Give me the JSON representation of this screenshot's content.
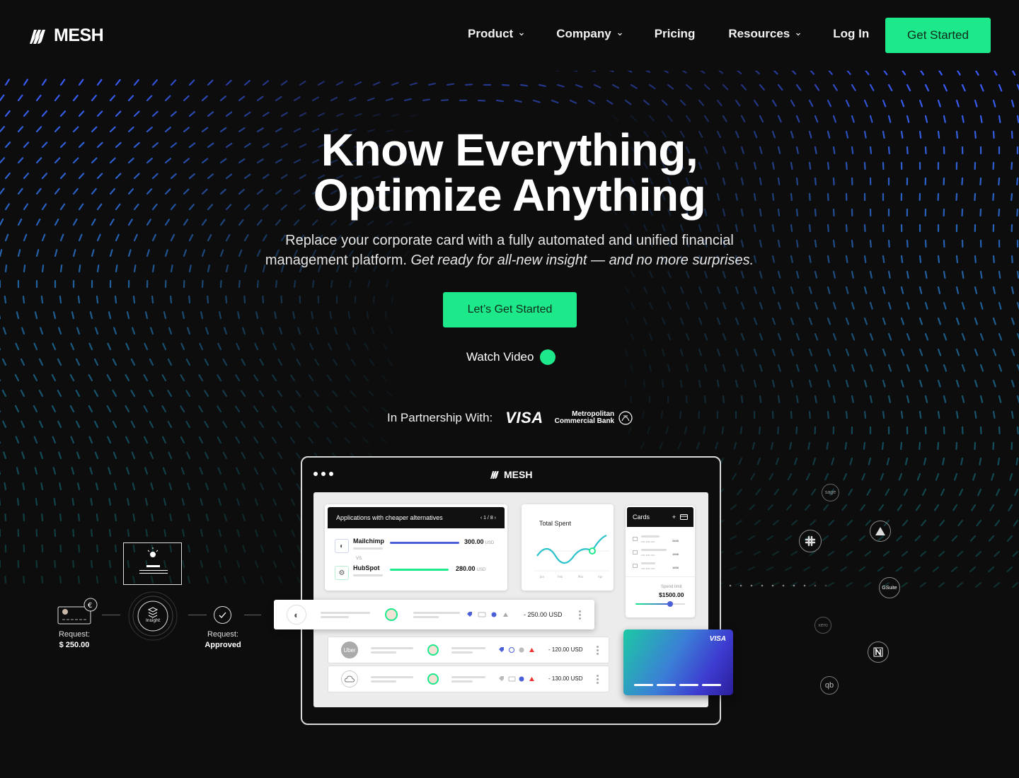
{
  "brand": {
    "name": "MESH"
  },
  "nav": {
    "items": [
      {
        "label": "Product",
        "has_dropdown": true
      },
      {
        "label": "Company",
        "has_dropdown": true
      },
      {
        "label": "Pricing",
        "has_dropdown": false
      },
      {
        "label": "Resources",
        "has_dropdown": true
      },
      {
        "label": "Log In",
        "has_dropdown": false
      }
    ],
    "cta": "Get Started"
  },
  "hero": {
    "title_line1": "Know Everything,",
    "title_line2": "Optimize Anything",
    "subtitle_plain": "Replace your corporate card with a fully automated and unified financial management platform. ",
    "subtitle_italic": "Get ready for all-new insight — and no more surprises.",
    "cta": "Let’s Get Started",
    "watch_video": "Watch Video"
  },
  "partnership": {
    "label": "In Partnership With:",
    "partners": [
      "VISA",
      "Metropolitan",
      "Commercial Bank"
    ]
  },
  "dashboard": {
    "logo": "MESH",
    "apps_card": {
      "title": "Applications with cheaper alternatives",
      "pager": "1 / 8",
      "vs": "VS.",
      "items": [
        {
          "name": "Mailchimp",
          "amount": "300.00",
          "currency": "USD",
          "bar_fraction": 1.0,
          "color": "#4b5fd6"
        },
        {
          "name": "HubSpot",
          "amount": "280.00",
          "currency": "USD",
          "bar_fraction": 0.85,
          "color": "#1de98b"
        }
      ]
    },
    "total_spent": {
      "title": "Total Spent",
      "months": [
        "Jan",
        "Feb",
        "Mar",
        "Apr"
      ]
    },
    "cards": {
      "title": "Cards",
      "items": [
        "3465",
        "1658",
        "1658"
      ],
      "spend_limit_label": "Spend limit",
      "spend_limit_value": "$1500.00",
      "slider_fraction": 0.7
    },
    "transactions": [
      {
        "merchant": "Mailchimp",
        "amount": "- 250.00 USD"
      },
      {
        "merchant": "Uber",
        "amount": "- 120.00 USD"
      },
      {
        "merchant": "Cloud",
        "amount": "- 130.00 USD"
      }
    ],
    "credit_card": {
      "brand": "VISA"
    }
  },
  "flow": {
    "request_label": "Request:",
    "request_amount": "$ 250.00",
    "insight_label": "Insight",
    "approved_label": "Request:",
    "approved_value": "Approved"
  },
  "integrations": [
    "sage",
    "slack",
    "atlassian",
    "gsuite",
    "xero",
    "netsuite",
    "quickbooks"
  ],
  "colors": {
    "accent": "#1de98b",
    "background": "#0d0d0d"
  }
}
